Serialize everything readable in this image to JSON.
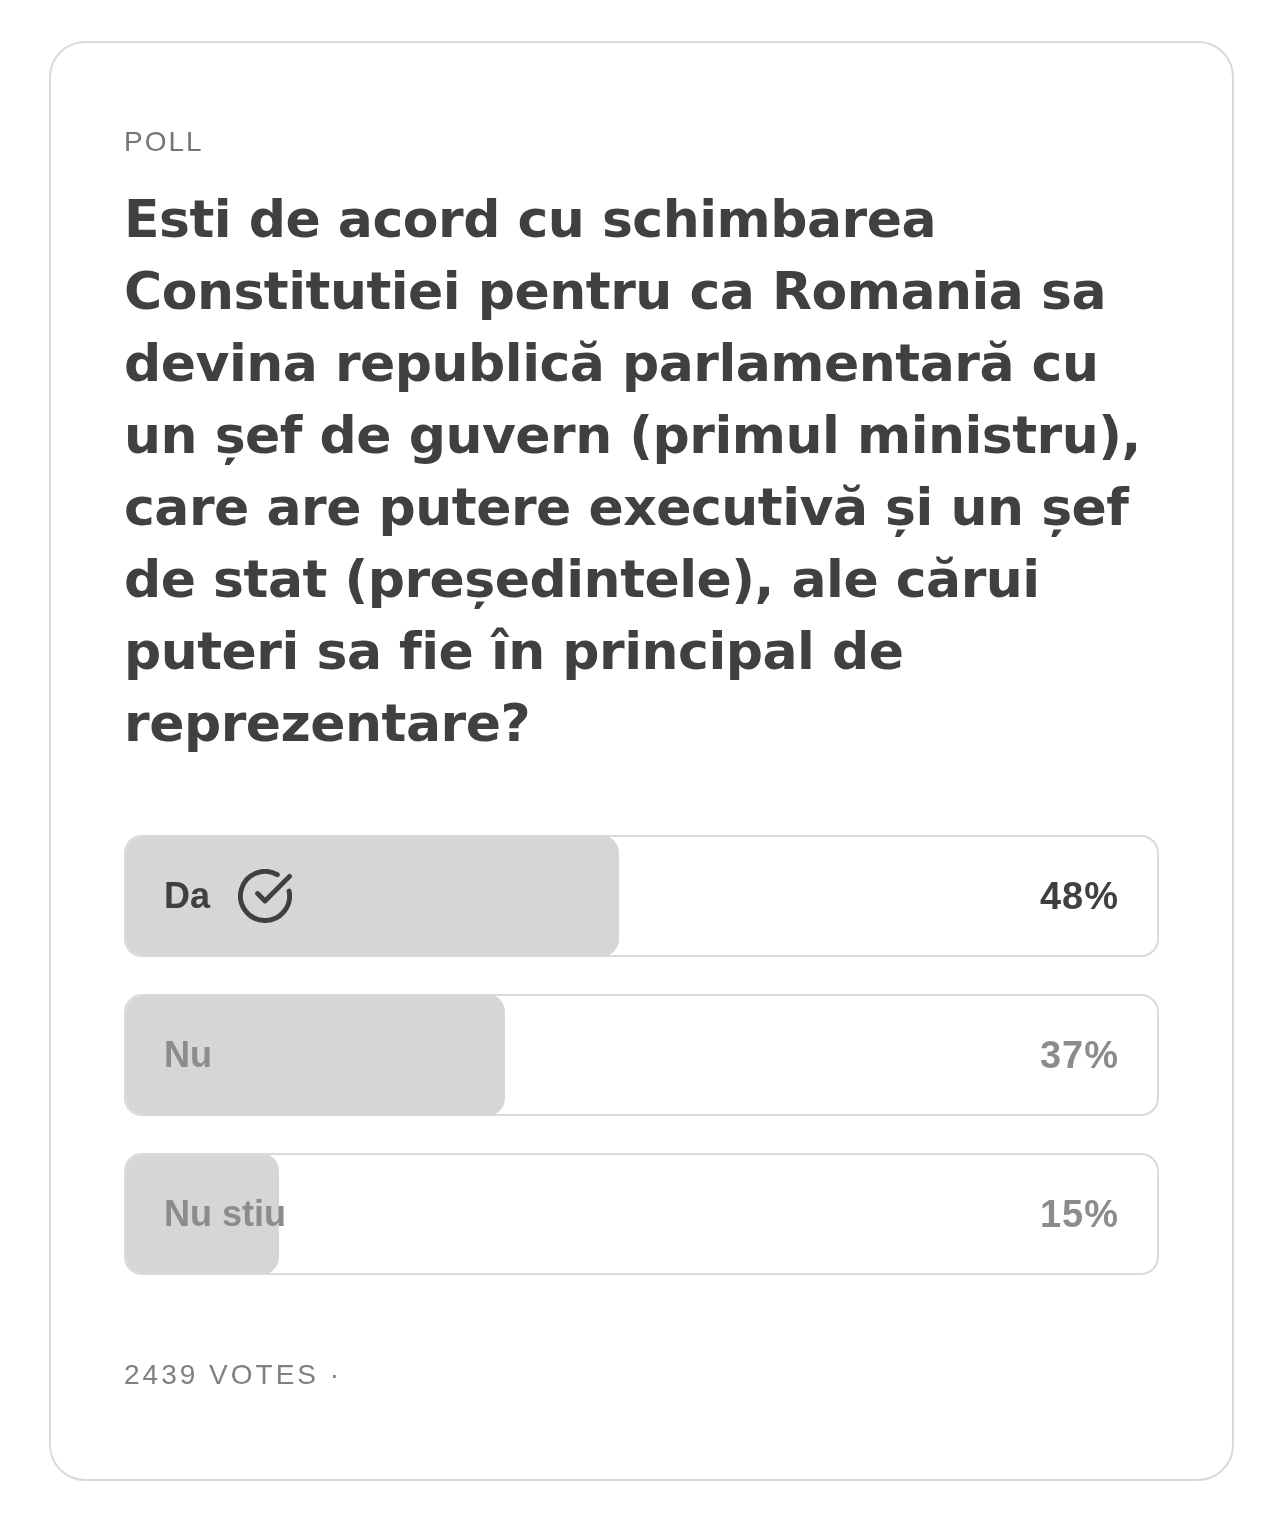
{
  "card": {
    "label": "POLL",
    "question": "Esti de acord cu schimbarea Constitutiei pentru ca Romania sa devina republică parlamentară cu un șef de guvern (primul ministru), care are putere executivă și un șef de stat (președintele), ale cărui puteri sa fie în principal de reprezentare?",
    "options": [
      {
        "label": "Da",
        "percent": "48%",
        "level": 0.48,
        "selected": true
      },
      {
        "label": "Nu",
        "percent": "37%",
        "level": 0.37,
        "selected": false
      },
      {
        "label": "Nu stiu",
        "percent": "15%",
        "level": 0.15,
        "selected": false
      }
    ],
    "votes": "2439 VOTES ·"
  }
}
